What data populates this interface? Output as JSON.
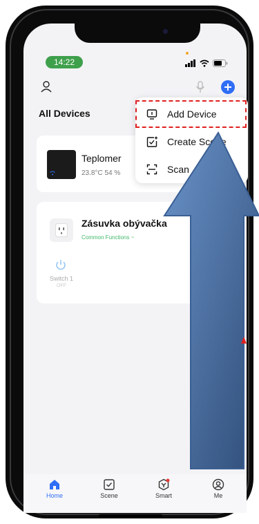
{
  "status": {
    "time": "14:22"
  },
  "header": {
    "title": "All Devices"
  },
  "devices": [
    {
      "name": "Teplomer",
      "reading": "23.8°C  54 %"
    },
    {
      "name": "Zásuvka obývačka",
      "subtitle": "Common Functions ~",
      "switch_label": "Switch 1",
      "switch_state": "OFF"
    }
  ],
  "menu": {
    "items": [
      {
        "label": "Add Device",
        "icon": "add-device-icon"
      },
      {
        "label": "Create Scene",
        "icon": "create-scene-icon"
      },
      {
        "label": "Scan",
        "icon": "scan-icon"
      }
    ]
  },
  "tabs": [
    {
      "label": "Home",
      "icon": "home-icon",
      "active": true
    },
    {
      "label": "Scene",
      "icon": "scene-icon"
    },
    {
      "label": "Smart",
      "icon": "smart-icon"
    },
    {
      "label": "Me",
      "icon": "me-icon"
    }
  ],
  "colors": {
    "accent": "#2f6ef5",
    "status_pill": "#3fa04c",
    "highlight": "#e02020",
    "arrow": "#3a5f94"
  }
}
